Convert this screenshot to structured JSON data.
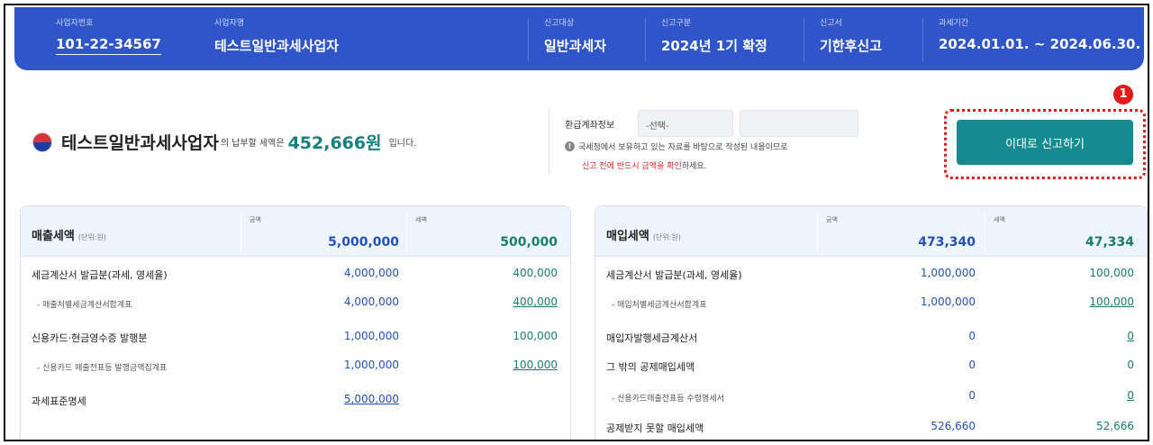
{
  "header": {
    "business_no": {
      "label": "사업자번호",
      "value": "101-22-34567"
    },
    "business_name": {
      "label": "사업자명",
      "value": "테스트일반과세사업자"
    },
    "report_target": {
      "label": "신고대상",
      "value": "일반과세자"
    },
    "report_type": {
      "label": "신고구분",
      "value": "2024년 1기 확정"
    },
    "report_form": {
      "label": "신고서",
      "value": "기한후신고"
    },
    "tax_period": {
      "label": "과세기간",
      "value": "2024.01.01. ~ 2024.06.30."
    }
  },
  "summary": {
    "company": "테스트일반과세사업자",
    "middle": "의 납부할 세액은",
    "amount": "452,666원",
    "tail": "입니다."
  },
  "refund": {
    "label": "환급계좌정보",
    "select_value": "-선택-",
    "notice_line1": "국세청에서 보유하고 있는 자료를 바탕으로 작성된 내용이므로",
    "notice_red": "신고 전에 반드시 금액을 확인",
    "notice_tail": "하세요."
  },
  "action": {
    "submit_label": "이대로 신고하기",
    "badge": "1"
  },
  "sales": {
    "title": "매출세액",
    "unit": "(단위:원)",
    "amount_header": "금액",
    "tax_header": "세액",
    "total_amount": "5,000,000",
    "total_tax": "500,000",
    "rows": [
      {
        "label": "세금계산서 발급분(과세, 영세율)",
        "amount": "4,000,000",
        "tax": "400,000"
      },
      {
        "label": "- 매출처별세금계산서합계표",
        "amount": "4,000,000",
        "tax": "400,000"
      },
      {
        "label": "신용카드·현금영수증 발행분",
        "amount": "1,000,000",
        "tax": "100,000"
      },
      {
        "label": "- 신용카드 매출전표등 발행금액집계표",
        "amount": "1,000,000",
        "tax": "100,000"
      },
      {
        "label": "과세표준명세",
        "amount": "5,000,000",
        "tax": ""
      }
    ]
  },
  "purchase": {
    "title": "매입세액",
    "unit": "(단위:원)",
    "amount_header": "금액",
    "tax_header": "세액",
    "total_amount": "473,340",
    "total_tax": "47,334",
    "rows": [
      {
        "label": "세금계산서 발급분(과세, 영세율)",
        "amount": "1,000,000",
        "tax": "100,000"
      },
      {
        "label": "- 매입처별세금계산서합계표",
        "amount": "1,000,000",
        "tax": "100,000"
      },
      {
        "label": "매입자발행세금계산서",
        "amount": "0",
        "tax": "0"
      },
      {
        "label": "그 밖의 공제매입세액",
        "amount": "0",
        "tax": "0"
      },
      {
        "label": "- 신용카드매출전표등 수령명세서",
        "amount": "0",
        "tax": "0"
      },
      {
        "label": "공제받지 못할 매입세액",
        "amount": "526,660",
        "tax": "52,666"
      }
    ]
  },
  "colors": {
    "header_bg": "#2f55c9",
    "accent_teal": "#138b8f",
    "amount_blue": "#2451b5",
    "tax_green": "#1b7c6c",
    "alert_red": "#e11b1b"
  }
}
